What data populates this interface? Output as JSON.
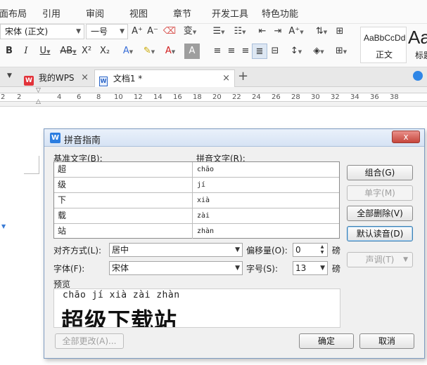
{
  "menu": [
    "页面布局",
    "引用",
    "审阅",
    "视图",
    "章节",
    "开发工具",
    "特色功能"
  ],
  "toolbar": {
    "font_name": "宋体 (正文)",
    "font_size": "一号",
    "styles": [
      {
        "sample": "AaBbCcDd",
        "name": "正文"
      },
      {
        "sample": "Aa",
        "name": "标题"
      }
    ]
  },
  "tabs": [
    {
      "label": "我的WPS"
    },
    {
      "label": "文档1 *"
    }
  ],
  "ruler": [
    "2",
    "2",
    "4",
    "6",
    "8",
    "10",
    "12",
    "14",
    "16",
    "18",
    "20",
    "22",
    "24",
    "26",
    "28",
    "30",
    "32",
    "34",
    "36",
    "38"
  ],
  "dialog": {
    "title": "拼音指南",
    "close_label": "x",
    "base_text_label": "基准文字(B):",
    "ruby_text_label": "拼音文字(R):",
    "rows": [
      {
        "base": "超",
        "pinyin": "chāo"
      },
      {
        "base": "级",
        "pinyin": "jí"
      },
      {
        "base": "下",
        "pinyin": "xià"
      },
      {
        "base": "载",
        "pinyin": "zài"
      },
      {
        "base": "站",
        "pinyin": "zhàn"
      }
    ],
    "buttons": {
      "group": "组合(G)",
      "mono": "单字(M)",
      "clear_all": "全部删除(V)",
      "default_reading": "默认读音(D)",
      "tone": "声调(T)"
    },
    "alignment_label": "对齐方式(L):",
    "alignment_value": "居中",
    "offset_label": "偏移量(O):",
    "offset_value": "0",
    "offset_unit": "磅",
    "font_label": "字体(F):",
    "font_value": "宋体",
    "size_label": "字号(S):",
    "size_value": "13",
    "size_unit": "磅",
    "preview_label": "预览",
    "preview_pinyin": "chāo jí  xià zài zhàn",
    "preview_text": "超级下载站",
    "change_all": "全部更改(A)...",
    "ok": "确定",
    "cancel": "取消"
  }
}
